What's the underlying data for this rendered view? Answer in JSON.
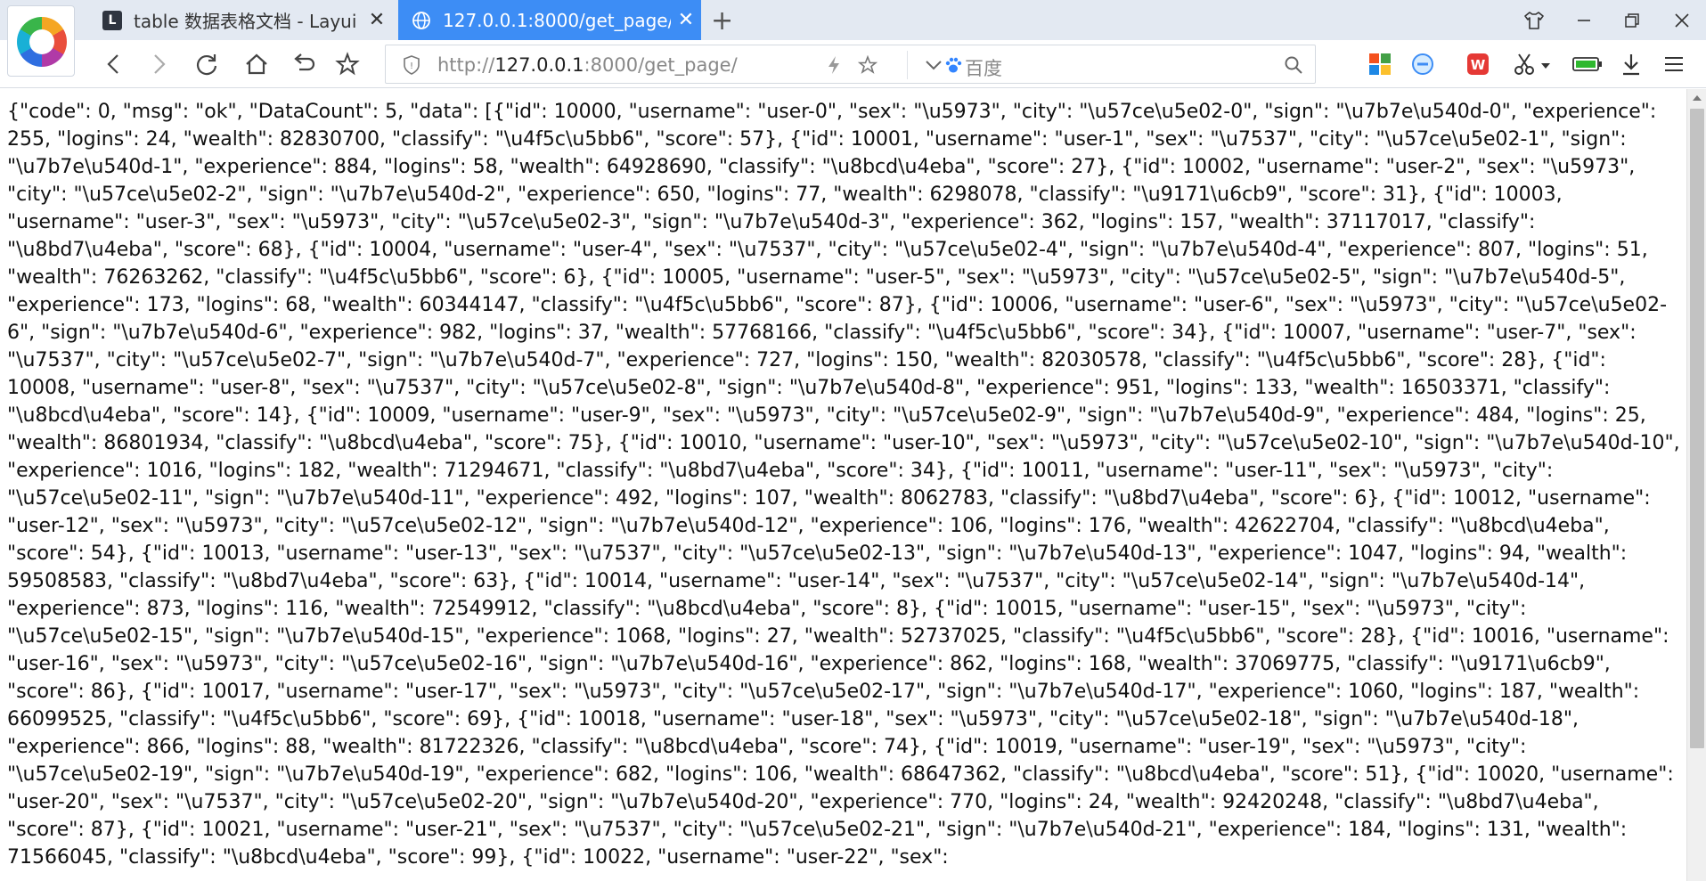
{
  "tabs": [
    {
      "title": "table 数据表格文档 - Layui",
      "favicon": "layui-icon",
      "active": false
    },
    {
      "title": "127.0.0.1:8000/get_page/",
      "favicon": "globe-icon",
      "active": true
    }
  ],
  "toolbar": {
    "url_prefix": "http://",
    "url_host": "127.0.0.1",
    "url_suffix": ":8000/get_page/",
    "search_placeholder": "百度"
  },
  "colors": {
    "active_tab": "#3d8df5",
    "tabstrip": "#e3e9f2"
  },
  "content": {
    "response_text": "{\"code\": 0, \"msg\": \"ok\", \"DataCount\": 5, \"data\": [{\"id\": 10000, \"username\": \"user-0\", \"sex\": \"\\u5973\", \"city\": \"\\u57ce\\u5e02-0\", \"sign\": \"\\u7b7e\\u540d-0\", \"experience\": 255, \"logins\": 24, \"wealth\": 82830700, \"classify\": \"\\u4f5c\\u5bb6\", \"score\": 57}, {\"id\": 10001, \"username\": \"user-1\", \"sex\": \"\\u7537\", \"city\": \"\\u57ce\\u5e02-1\", \"sign\": \"\\u7b7e\\u540d-1\", \"experience\": 884, \"logins\": 58, \"wealth\": 64928690, \"classify\": \"\\u8bcd\\u4eba\", \"score\": 27}, {\"id\": 10002, \"username\": \"user-2\", \"sex\": \"\\u5973\", \"city\": \"\\u57ce\\u5e02-2\", \"sign\": \"\\u7b7e\\u540d-2\", \"experience\": 650, \"logins\": 77, \"wealth\": 6298078, \"classify\": \"\\u9171\\u6cb9\", \"score\": 31}, {\"id\": 10003, \"username\": \"user-3\", \"sex\": \"\\u5973\", \"city\": \"\\u57ce\\u5e02-3\", \"sign\": \"\\u7b7e\\u540d-3\", \"experience\": 362, \"logins\": 157, \"wealth\": 37117017, \"classify\": \"\\u8bd7\\u4eba\", \"score\": 68}, {\"id\": 10004, \"username\": \"user-4\", \"sex\": \"\\u7537\", \"city\": \"\\u57ce\\u5e02-4\", \"sign\": \"\\u7b7e\\u540d-4\", \"experience\": 807, \"logins\": 51, \"wealth\": 76263262, \"classify\": \"\\u4f5c\\u5bb6\", \"score\": 6}, {\"id\": 10005, \"username\": \"user-5\", \"sex\": \"\\u5973\", \"city\": \"\\u57ce\\u5e02-5\", \"sign\": \"\\u7b7e\\u540d-5\", \"experience\": 173, \"logins\": 68, \"wealth\": 60344147, \"classify\": \"\\u4f5c\\u5bb6\", \"score\": 87}, {\"id\": 10006, \"username\": \"user-6\", \"sex\": \"\\u5973\", \"city\": \"\\u57ce\\u5e02-6\", \"sign\": \"\\u7b7e\\u540d-6\", \"experience\": 982, \"logins\": 37, \"wealth\": 57768166, \"classify\": \"\\u4f5c\\u5bb6\", \"score\": 34}, {\"id\": 10007, \"username\": \"user-7\", \"sex\": \"\\u7537\", \"city\": \"\\u57ce\\u5e02-7\", \"sign\": \"\\u7b7e\\u540d-7\", \"experience\": 727, \"logins\": 150, \"wealth\": 82030578, \"classify\": \"\\u4f5c\\u5bb6\", \"score\": 28}, {\"id\": 10008, \"username\": \"user-8\", \"sex\": \"\\u7537\", \"city\": \"\\u57ce\\u5e02-8\", \"sign\": \"\\u7b7e\\u540d-8\", \"experience\": 951, \"logins\": 133, \"wealth\": 16503371, \"classify\": \"\\u8bcd\\u4eba\", \"score\": 14}, {\"id\": 10009, \"username\": \"user-9\", \"sex\": \"\\u5973\", \"city\": \"\\u57ce\\u5e02-9\", \"sign\": \"\\u7b7e\\u540d-9\", \"experience\": 484, \"logins\": 25, \"wealth\": 86801934, \"classify\": \"\\u8bcd\\u4eba\", \"score\": 75}, {\"id\": 10010, \"username\": \"user-10\", \"sex\": \"\\u5973\", \"city\": \"\\u57ce\\u5e02-10\", \"sign\": \"\\u7b7e\\u540d-10\", \"experience\": 1016, \"logins\": 182, \"wealth\": 71294671, \"classify\": \"\\u8bd7\\u4eba\", \"score\": 34}, {\"id\": 10011, \"username\": \"user-11\", \"sex\": \"\\u5973\", \"city\": \"\\u57ce\\u5e02-11\", \"sign\": \"\\u7b7e\\u540d-11\", \"experience\": 492, \"logins\": 107, \"wealth\": 8062783, \"classify\": \"\\u8bd7\\u4eba\", \"score\": 6}, {\"id\": 10012, \"username\": \"user-12\", \"sex\": \"\\u5973\", \"city\": \"\\u57ce\\u5e02-12\", \"sign\": \"\\u7b7e\\u540d-12\", \"experience\": 106, \"logins\": 176, \"wealth\": 42622704, \"classify\": \"\\u8bcd\\u4eba\", \"score\": 54}, {\"id\": 10013, \"username\": \"user-13\", \"sex\": \"\\u7537\", \"city\": \"\\u57ce\\u5e02-13\", \"sign\": \"\\u7b7e\\u540d-13\", \"experience\": 1047, \"logins\": 94, \"wealth\": 59508583, \"classify\": \"\\u8bd7\\u4eba\", \"score\": 63}, {\"id\": 10014, \"username\": \"user-14\", \"sex\": \"\\u7537\", \"city\": \"\\u57ce\\u5e02-14\", \"sign\": \"\\u7b7e\\u540d-14\", \"experience\": 873, \"logins\": 116, \"wealth\": 72549912, \"classify\": \"\\u8bcd\\u4eba\", \"score\": 8}, {\"id\": 10015, \"username\": \"user-15\", \"sex\": \"\\u5973\", \"city\": \"\\u57ce\\u5e02-15\", \"sign\": \"\\u7b7e\\u540d-15\", \"experience\": 1068, \"logins\": 27, \"wealth\": 52737025, \"classify\": \"\\u4f5c\\u5bb6\", \"score\": 28}, {\"id\": 10016, \"username\": \"user-16\", \"sex\": \"\\u5973\", \"city\": \"\\u57ce\\u5e02-16\", \"sign\": \"\\u7b7e\\u540d-16\", \"experience\": 862, \"logins\": 168, \"wealth\": 37069775, \"classify\": \"\\u9171\\u6cb9\", \"score\": 86}, {\"id\": 10017, \"username\": \"user-17\", \"sex\": \"\\u5973\", \"city\": \"\\u57ce\\u5e02-17\", \"sign\": \"\\u7b7e\\u540d-17\", \"experience\": 1060, \"logins\": 187, \"wealth\": 66099525, \"classify\": \"\\u4f5c\\u5bb6\", \"score\": 69}, {\"id\": 10018, \"username\": \"user-18\", \"sex\": \"\\u5973\", \"city\": \"\\u57ce\\u5e02-18\", \"sign\": \"\\u7b7e\\u540d-18\", \"experience\": 866, \"logins\": 88, \"wealth\": 81722326, \"classify\": \"\\u8bcd\\u4eba\", \"score\": 74}, {\"id\": 10019, \"username\": \"user-19\", \"sex\": \"\\u5973\", \"city\": \"\\u57ce\\u5e02-19\", \"sign\": \"\\u7b7e\\u540d-19\", \"experience\": 682, \"logins\": 106, \"wealth\": 68647362, \"classify\": \"\\u8bcd\\u4eba\", \"score\": 51}, {\"id\": 10020, \"username\": \"user-20\", \"sex\": \"\\u7537\", \"city\": \"\\u57ce\\u5e02-20\", \"sign\": \"\\u7b7e\\u540d-20\", \"experience\": 770, \"logins\": 24, \"wealth\": 92420248, \"classify\": \"\\u8bd7\\u4eba\", \"score\": 87}, {\"id\": 10021, \"username\": \"user-21\", \"sex\": \"\\u7537\", \"city\": \"\\u57ce\\u5e02-21\", \"sign\": \"\\u7b7e\\u540d-21\", \"experience\": 184, \"logins\": 131, \"wealth\": 71566045, \"classify\": \"\\u8bcd\\u4eba\", \"score\": 99}, {\"id\": 10022, \"username\": \"user-22\", \"sex\":"
  }
}
